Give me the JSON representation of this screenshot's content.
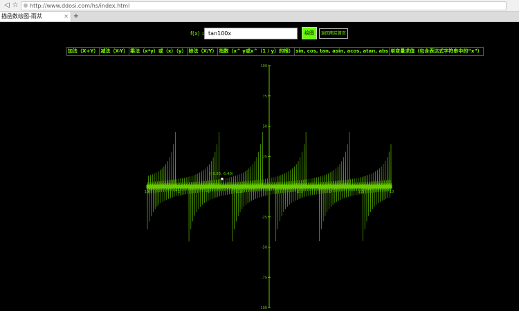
{
  "browser": {
    "url": "http://www.ddosi.com/hs/index.html",
    "tab_title": "描函数绘图-雨苁",
    "tab_close": "×",
    "add_tab": "+",
    "back": "◁",
    "refresh": "☆"
  },
  "form": {
    "fx_label": "f(x) =",
    "input_value": "tan100x",
    "draw_label": "绘图",
    "home_label": "返回雨苁首页"
  },
  "help_items": [
    "加法（X+Y）",
    "减法（X-Y）",
    "乘法（x*y）或（x）（y）",
    "除法（X/Y）",
    "指数（x^ y或x^（1 / y）的根）",
    "sin, cos, tan, asin, acos, atan, abs",
    "单变量求值（包含表达式字符串中的“x”）"
  ],
  "graph": {
    "y_ticks": [
      {
        "value": 100,
        "label": "100"
      },
      {
        "value": 75,
        "label": "75"
      },
      {
        "value": 50,
        "label": "50"
      },
      {
        "value": 25,
        "label": "25"
      },
      {
        "value": -25,
        "label": "-25"
      },
      {
        "value": -50,
        "label": "-50"
      },
      {
        "value": -75,
        "label": "-75"
      },
      {
        "value": -100,
        "label": "-100"
      }
    ],
    "x_ticks": [
      {
        "value": -10,
        "label": "10"
      },
      {
        "value": -7.5,
        "label": "-7.5"
      },
      {
        "value": -5,
        "label": "-5"
      },
      {
        "value": -2.5,
        "label": "-2.5"
      },
      {
        "value": 2.5,
        "label": "2.5"
      },
      {
        "value": 5,
        "label": "5"
      },
      {
        "value": 7.5,
        "label": "7.5"
      },
      {
        "value": 10,
        "label": "10"
      }
    ],
    "point_label": "(-3.85, 6.40)",
    "point": {
      "x": -3.85,
      "y": 6.4
    },
    "x_range": [
      -10,
      10
    ],
    "y_range": [
      -100,
      100
    ],
    "line_color": "#66cc00",
    "axis_color": "#66cc00"
  }
}
